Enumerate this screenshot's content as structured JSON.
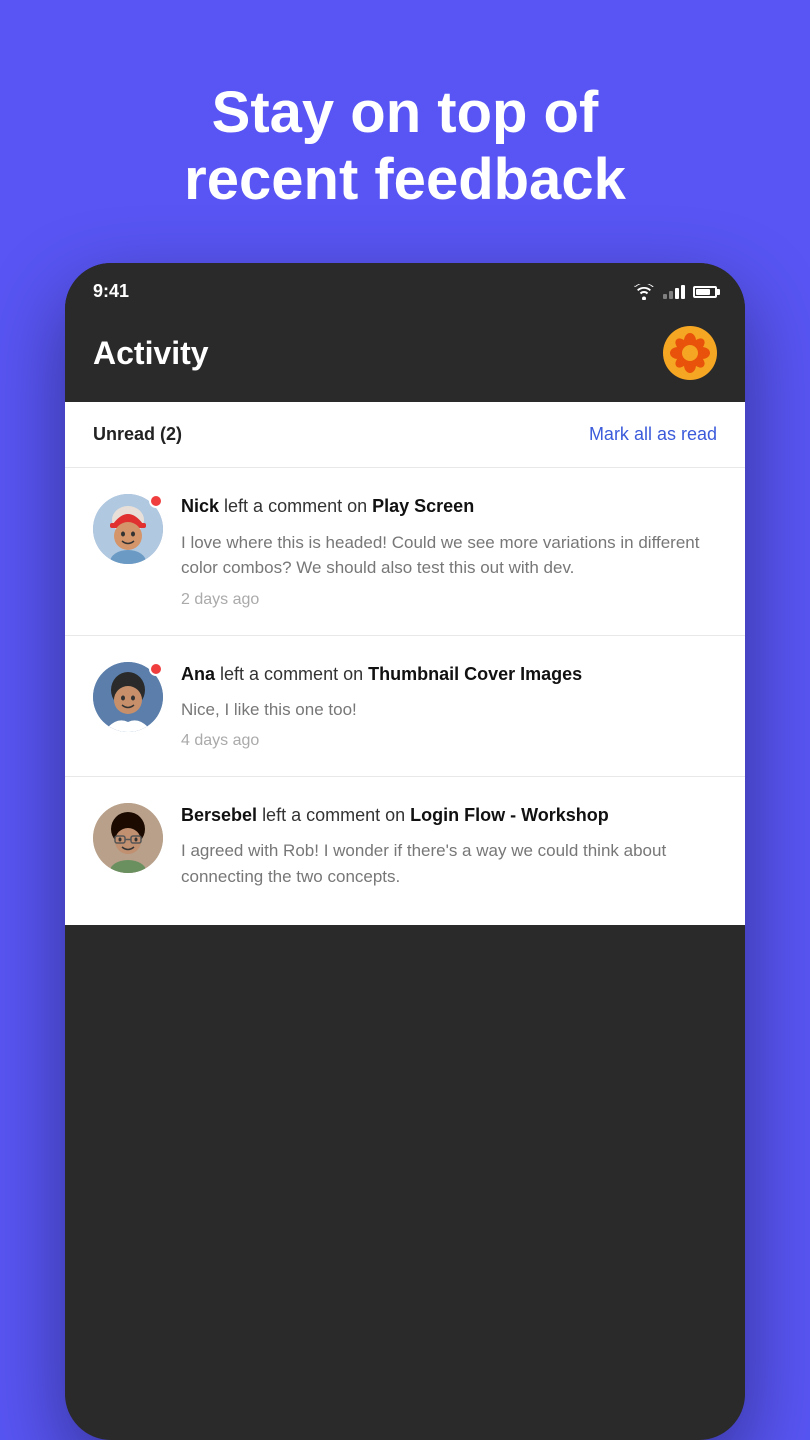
{
  "hero": {
    "line1": "Stay on top of",
    "line2": "recent feedback"
  },
  "statusBar": {
    "time": "9:41"
  },
  "appHeader": {
    "title": "Activity"
  },
  "unreadSection": {
    "label": "Unread (2)",
    "markAllRead": "Mark all as read"
  },
  "activities": [
    {
      "id": "nick",
      "userName": "Nick",
      "action": " left a comment on ",
      "projectName": "Play Screen",
      "comment": "I love where this is headed! Could we see more variations in different color combos? We should also test this out with dev.",
      "timeAgo": "2 days ago",
      "unread": true,
      "avatarColor1": "#b8cde0",
      "avatarColor2": "#8eacca"
    },
    {
      "id": "ana",
      "userName": "Ana",
      "action": " left a comment on ",
      "projectName": "Thumbnail Cover Images",
      "comment": "Nice, I like this one too!",
      "timeAgo": "4 days ago",
      "unread": true,
      "avatarColor1": "#5b8ec4",
      "avatarColor2": "#3a6fa8"
    },
    {
      "id": "bersebel",
      "userName": "Bersebel",
      "action": " left a comment on ",
      "projectName": "Login Flow - Workshop",
      "comment": "I agreed with Rob! I wonder if there's a way we could think about connecting the two concepts.",
      "timeAgo": "",
      "unread": false,
      "avatarColor1": "#c4a882",
      "avatarColor2": "#9e8060"
    }
  ],
  "icons": {
    "flowerEmoji": "✿",
    "wifi": "wifi-icon",
    "signal": "signal-icon",
    "battery": "battery-icon"
  }
}
